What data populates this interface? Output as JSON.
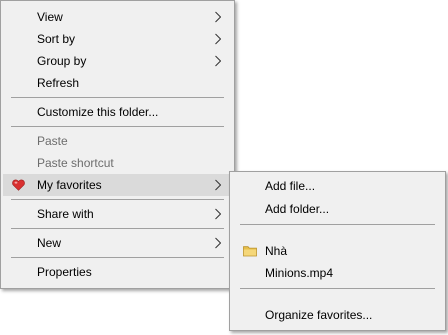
{
  "main_menu": {
    "view": "View",
    "sort_by": "Sort by",
    "group_by": "Group by",
    "refresh": "Refresh",
    "customize": "Customize this folder...",
    "paste": "Paste",
    "paste_shortcut": "Paste shortcut",
    "my_favorites": "My favorites",
    "share_with": "Share with",
    "new": "New",
    "properties": "Properties"
  },
  "sub_menu": {
    "add_file": "Add file...",
    "add_folder": "Add folder...",
    "favorites": [
      {
        "label": "Nhà",
        "icon": "folder-icon"
      },
      {
        "label": "Minions.mp4",
        "icon": null
      }
    ],
    "organize": "Organize favorites..."
  },
  "colors": {
    "menu_bg": "#f0f0f0",
    "highlight": "#dadada",
    "disabled_text": "#6d6d6d",
    "heart": "#d93030",
    "folder": "#e8c04a"
  }
}
